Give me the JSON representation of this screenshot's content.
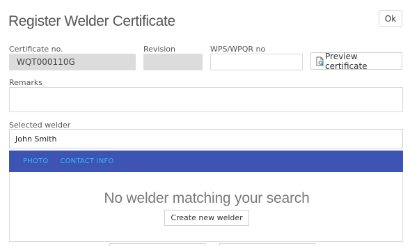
{
  "dialog": {
    "title": "Register Welder Certificate",
    "ok_label": "Ok"
  },
  "form": {
    "certificate_label": "Certificate no.",
    "certificate_value": "WQT000110G",
    "revision_label": "Revision",
    "revision_value": "",
    "wps_label": "WPS/WPQR no",
    "wps_value": "",
    "preview_label": "Preview certificate",
    "remarks_label": "Remarks",
    "remarks_value": ""
  },
  "welder": {
    "selected_label": "Selected welder",
    "selected_value": "John Smith",
    "tabs": [
      {
        "label": "PHOTO"
      },
      {
        "label": "CONTACT INFO"
      }
    ],
    "empty_message": "No welder matching your search",
    "create_label": "Create new welder"
  },
  "colors": {
    "tabbar_bg": "#3d54b4",
    "tab_text": "#35b7f3",
    "readonly_bg": "#dcdcdc"
  },
  "icons": {
    "preview": "document-magnifier-icon"
  }
}
